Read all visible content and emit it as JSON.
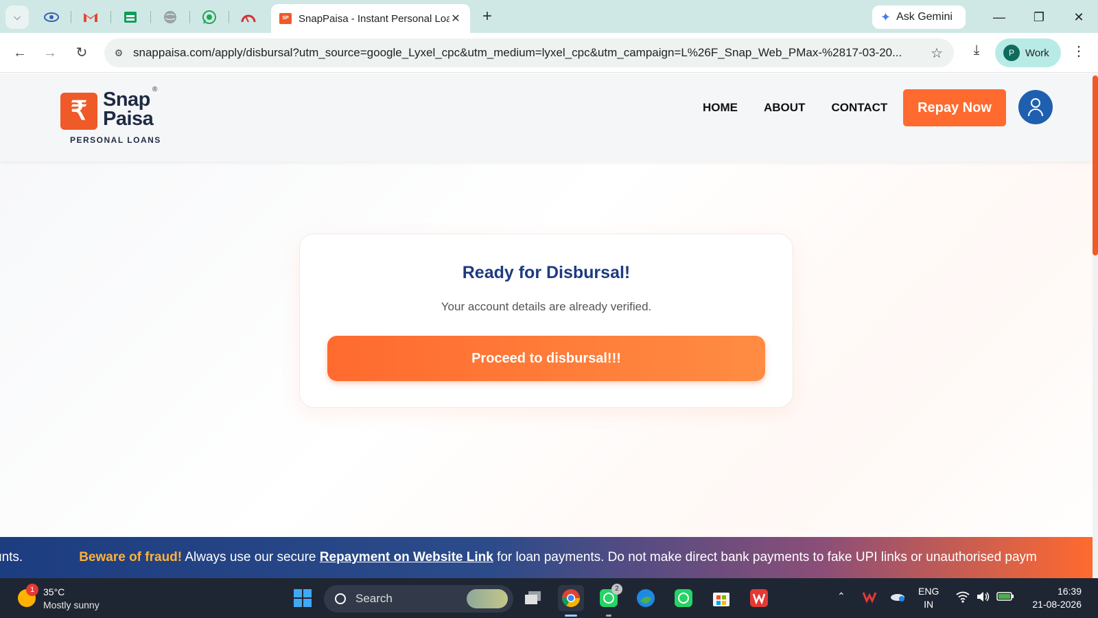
{
  "browser": {
    "tab_title": "SnapPaisa - Instant Personal Loans",
    "ask_gemini": "Ask Gemini",
    "url": "snappaisa.com/apply/disbursal?utm_source=google_Lyxel_cpc&utm_medium=lyxel_cpc&utm_campaign=L%26F_Snap_Web_PMax-%2817-03-20...",
    "profile_initial": "P",
    "profile_label": "Work",
    "new_tab_symbol": "+"
  },
  "site": {
    "logo_word": "Snap Paisa",
    "logo_sub": "PERSONAL LOANS",
    "logo_symbol": "₹",
    "nav": [
      "HOME",
      "ABOUT",
      "CONTACT"
    ],
    "repay_label": "Repay Now"
  },
  "card": {
    "title": "Ready for Disbursal!",
    "subtitle": "Your account details are already verified.",
    "button_label": "Proceed to disbursal!!!"
  },
  "ticker": {
    "lead": "unts.",
    "warning": "Beware of fraud!",
    "text1": " Always use our secure ",
    "link": "Repayment on Website Link",
    "text2": " for loan payments. Do not make direct bank payments to fake UPI links or unauthorised paym"
  },
  "taskbar": {
    "weather_badge": "1",
    "temperature": "35°C",
    "weather_desc": "Mostly sunny",
    "search_label": "Search",
    "whatsapp_badge": "2",
    "lang_line1": "ENG",
    "lang_line2": "IN",
    "time": "16:39",
    "date": "21-08-2026"
  },
  "colors": {
    "brand_orange": "#ff6a2f",
    "brand_navy": "#1d3a80",
    "tab_strip": "#cfe8e6"
  }
}
